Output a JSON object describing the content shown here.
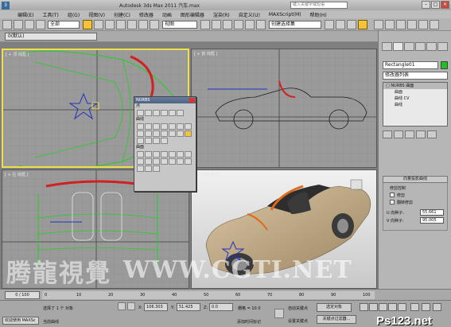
{
  "window": {
    "title": "Autodesk 3ds Max  2011     汽车.max",
    "search_placeholder": "键入关键字或短语",
    "logo": "3"
  },
  "menu": [
    "编辑(E)",
    "工具(T)",
    "组(G)",
    "视图(V)",
    "创建(C)",
    "修改器",
    "动画",
    "图形编辑器",
    "渲染(R)",
    "自定义(U)",
    "MAXScript(M)",
    "帮助(H)"
  ],
  "toolbar": {
    "selection_filter": "全部",
    "ref_coord": "视图",
    "named_selection": "创建选择集"
  },
  "layer": {
    "current": "0(默认)"
  },
  "viewports": {
    "top_left": "[ + 顶 线框 ]",
    "top_right": "[ + 前 线框 ]",
    "bottom_left": "[ + 左 线框 ]",
    "bottom_right": "[ + 透视 真实 ]"
  },
  "nurbs_palette": {
    "title": "NURBS",
    "sections": {
      "points": "点",
      "curves": "曲线",
      "surfaces": "曲面"
    }
  },
  "command_panel": {
    "object_name": "Rectangle01",
    "object_color": "#20c020",
    "modifier_list": "修改器列表",
    "stack": [
      {
        "label": "□ NURBS 曲面",
        "selected": true,
        "sub": false
      },
      {
        "label": "曲面",
        "selected": false,
        "sub": true
      },
      {
        "label": "曲线 CV",
        "selected": false,
        "sub": true
      },
      {
        "label": "曲线",
        "selected": false,
        "sub": true
      }
    ],
    "rollout_title": "向量投影曲线",
    "group": "修剪控制",
    "trim_checkbox": "修剪",
    "flip_trim_checkbox": "翻转修剪",
    "u_seed_label": "U 向种子:",
    "u_seed_value": "55.661",
    "v_seed_label": "V 向种子:",
    "v_seed_value": "95.005"
  },
  "timeline": {
    "slider": "0 / 100",
    "ticks": [
      "0",
      "10",
      "20",
      "30",
      "40",
      "50",
      "60",
      "70",
      "80",
      "90",
      "100"
    ]
  },
  "status": {
    "selection": "选择了 1 个 对象",
    "prompt": "当前曲线",
    "x_label": "X:",
    "x_value": "106.303",
    "y_label": "Y:",
    "y_value": "51.425",
    "z_label": "Z:",
    "z_value": "0.0",
    "grid": "栅格 = 10.0",
    "add_time_tag": "添加时间标记",
    "auto_key": "自动关键点",
    "set_key": "设置关键点",
    "key_filter_select": "选定对象",
    "key_filters": "关键点过滤器...",
    "maxscript": "欢迎使用 MAXSc"
  },
  "watermarks": {
    "chinese": "腾龍視覺",
    "url": "WWW.CGTI.NET",
    "badge": "Ps123.net"
  }
}
